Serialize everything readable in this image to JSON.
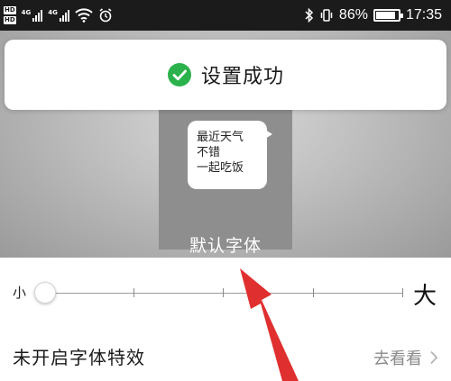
{
  "status_bar": {
    "hd_badges": [
      "HD",
      "HD"
    ],
    "signal_tags": [
      "4G",
      "4G"
    ],
    "battery_percent": 86,
    "battery_text": "86%",
    "time": "17:35",
    "icons": [
      "bluetooth-icon",
      "vibrate-icon",
      "wifi-icon",
      "alarm-icon"
    ]
  },
  "toast": {
    "text": "设置成功",
    "icon": "check-circle-icon",
    "color": "#2bb24c"
  },
  "preview": {
    "bubble_lines": [
      "最近天气",
      "不错",
      "一起吃饭"
    ],
    "caption": "默认字体"
  },
  "font_slider": {
    "min_label": "小",
    "max_label": "大",
    "steps": 5,
    "selected_step": 0
  },
  "effect_row": {
    "title": "未开启字体特效",
    "link_label": "去看看",
    "chevron_icon": "chevron-right-icon"
  },
  "annotation": {
    "arrow_color": "#e02f2f"
  }
}
